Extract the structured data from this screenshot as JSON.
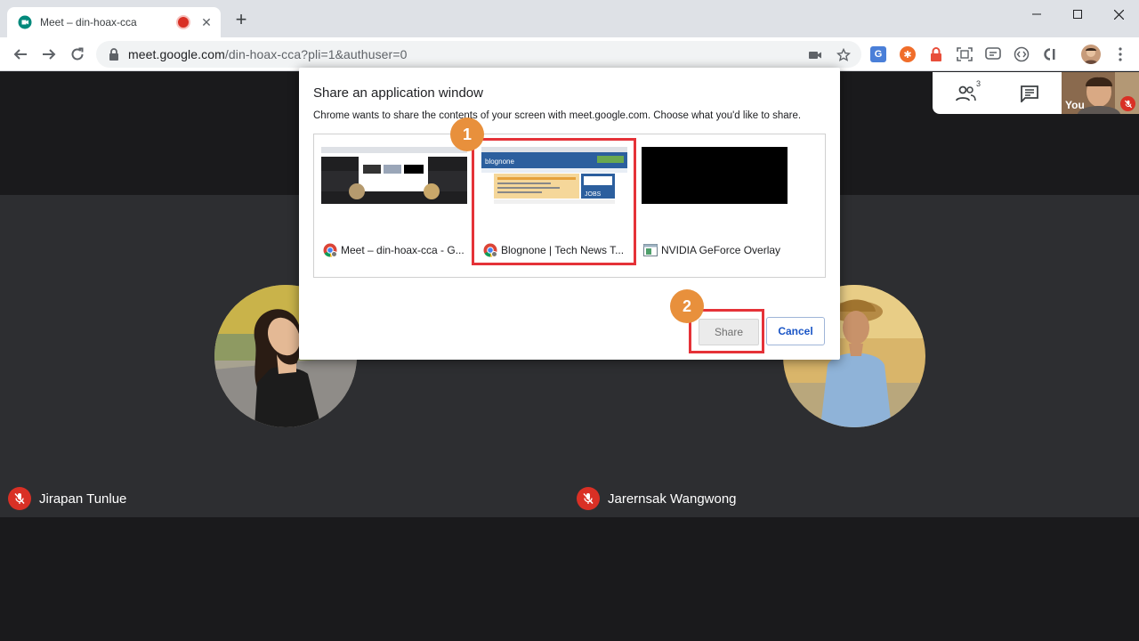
{
  "browser": {
    "tab_title": "Meet – din-hoax-cca",
    "tab_close": "✕",
    "new_tab": "+",
    "url_host": "meet.google.com",
    "url_path": "/din-hoax-cca?pli=1&authuser=0",
    "window_controls": {
      "minimize": "—",
      "maximize": "☐",
      "close": "✕"
    }
  },
  "meet": {
    "people_count": "3",
    "self_label": "You",
    "participants": [
      {
        "name": "Jirapan Tunlue",
        "muted": true
      },
      {
        "name": "Jarernsak Wangwong",
        "muted": true
      }
    ]
  },
  "dialog": {
    "title": "Share an application window",
    "description": "Chrome wants to share the contents of your screen with meet.google.com. Choose what you'd like to share.",
    "windows": [
      {
        "label": "Meet – din-hoax-cca - G...",
        "icon": "chrome-icon"
      },
      {
        "label": "Blognone | Tech News T...",
        "icon": "chrome-icon",
        "selected": true
      },
      {
        "label": "NVIDIA GeForce Overlay",
        "icon": "app-window-icon"
      }
    ],
    "share_label": "Share",
    "cancel_label": "Cancel",
    "step_1": "1",
    "step_2": "2",
    "thumb_text": {
      "blog_brand": "blognone",
      "blog_jobs": "JOBS"
    }
  },
  "colors": {
    "highlight": "#e53238",
    "step_badge": "#e8903c",
    "mic_off": "#d93025",
    "meet_bg": "#202124"
  }
}
